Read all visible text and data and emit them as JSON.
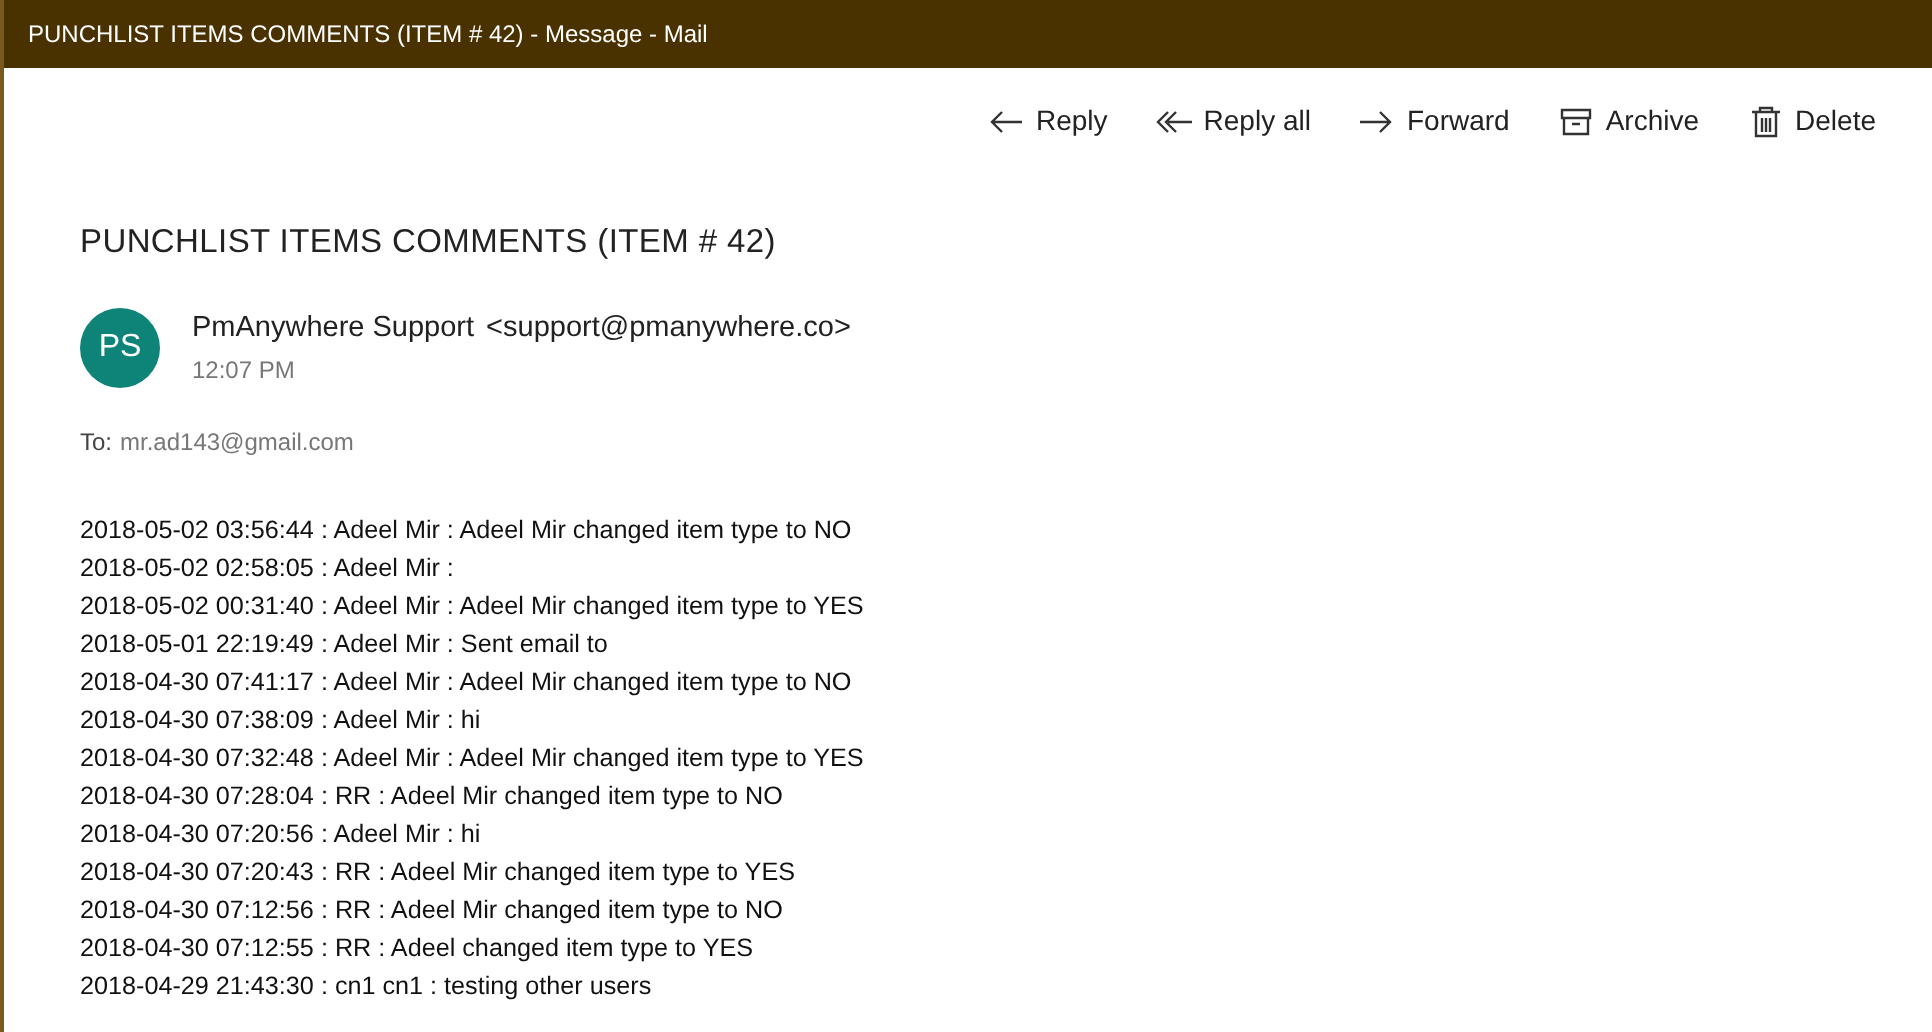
{
  "window": {
    "title": "PUNCHLIST ITEMS COMMENTS (ITEM # 42) - Message - Mail"
  },
  "toolbar": [
    {
      "kind": "reply",
      "label": "Reply"
    },
    {
      "kind": "reply-all",
      "label": "Reply all"
    },
    {
      "kind": "forward",
      "label": "Forward"
    },
    {
      "kind": "archive",
      "label": "Archive"
    },
    {
      "kind": "delete",
      "label": "Delete"
    }
  ],
  "message": {
    "subject": "PUNCHLIST ITEMS COMMENTS (ITEM # 42)",
    "avatar": "PS",
    "sender": "PmAnywhere Support",
    "sender_email": "<support@pmanywhere.co>",
    "time": "12:07 PM",
    "to_label": "To:",
    "to": "mr.ad143@gmail.com",
    "body_lines": [
      "2018-05-02 03:56:44 : Adeel Mir : Adeel Mir changed item type to NO",
      "2018-05-02 02:58:05 : Adeel Mir :",
      "2018-05-02 00:31:40 : Adeel Mir : Adeel Mir changed item type to YES",
      "2018-05-01 22:19:49 : Adeel Mir : Sent email to",
      "2018-04-30 07:41:17 : Adeel Mir : Adeel Mir changed item type to NO",
      "2018-04-30 07:38:09 : Adeel Mir : hi",
      "2018-04-30 07:32:48 : Adeel Mir : Adeel Mir changed item type to YES",
      "2018-04-30 07:28:04 : RR : Adeel Mir changed item type to NO",
      "2018-04-30 07:20:56 : Adeel Mir : hi",
      "2018-04-30 07:20:43 : RR : Adeel Mir changed item type to YES",
      "2018-04-30 07:12:56 : RR : Adeel Mir changed item type to NO",
      "2018-04-30 07:12:55 : RR : Adeel changed item type to YES",
      "2018-04-29 21:43:30 : cn1 cn1 : testing other users"
    ]
  }
}
